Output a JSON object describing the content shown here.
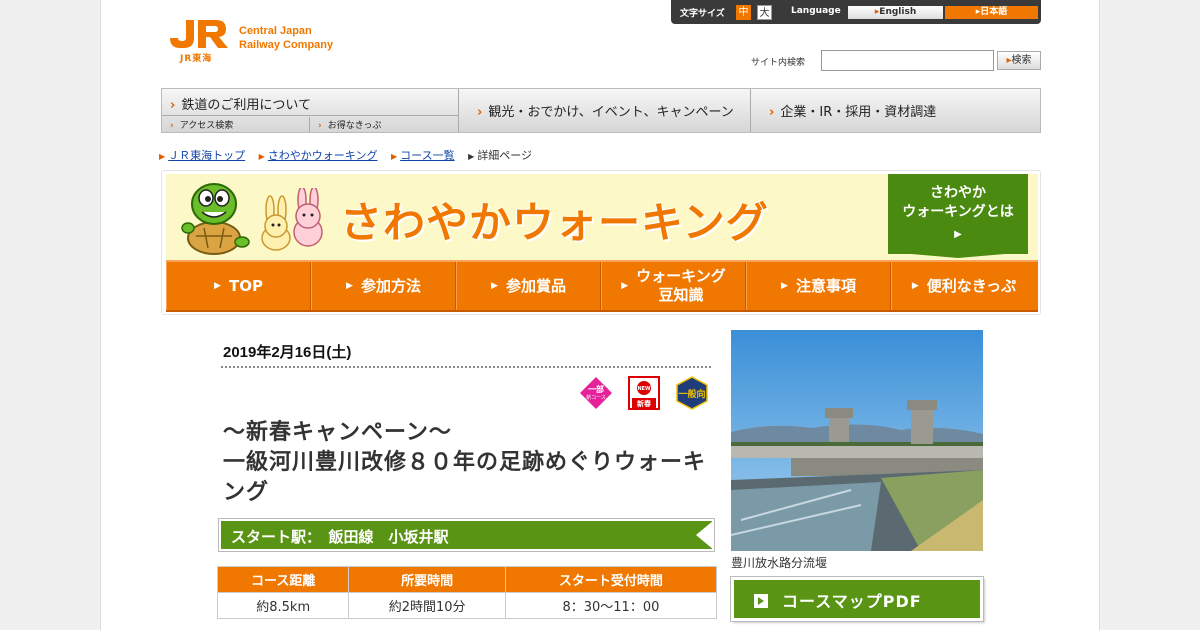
{
  "header": {
    "logo_sub": "JR東海",
    "logo_line1": "Central Japan",
    "logo_line2": "Railway Company",
    "font_size_label": "文字サイズ",
    "font_size_mid": "中",
    "font_size_big": "大",
    "language_label": "Language",
    "lang_english": "English",
    "lang_japanese": "日本語",
    "search_label": "サイト内検索",
    "search_value": "",
    "search_button": "検索"
  },
  "global_nav": {
    "item1": "鉄道のご利用について",
    "item1_sub1": "アクセス検索",
    "item1_sub2": "お得なきっぷ",
    "item2": "観光・おでかけ、イベント、キャンペーン",
    "item3": "企業・IR・採用・資材調達"
  },
  "breadcrumb": {
    "c1": "ＪＲ東海トップ",
    "c2": "さわやかウォーキング",
    "c3": "コース一覧",
    "c4": "詳細ページ"
  },
  "banner": {
    "title": "さわやかウォーキング",
    "about_line1": "さわやか",
    "about_line2": "ウォーキングとは"
  },
  "section_nav": {
    "top": "TOP",
    "how": "参加方法",
    "prize": "参加賞品",
    "tips_line1": "ウォーキング",
    "tips_line2": "豆知識",
    "notes": "注意事項",
    "tickets": "便利なきっぷ"
  },
  "event": {
    "date": "2019年2月16日(土)",
    "badge1_line1": "一部",
    "badge1_line2": "新コース",
    "badge2_line1": "NEW",
    "badge2_line2": "新春",
    "badge3": "一般向",
    "title_line1": "～新春キャンペーン～",
    "title_line2": "一級河川豊川改修８０年の足跡めぐりウォーキ",
    "title_line3": "ング",
    "start_station": "スタート駅：　飯田線　小坂井駅"
  },
  "info_table": {
    "headers": [
      "コース距離",
      "所要時間",
      "スタート受付時間"
    ],
    "values": [
      "約8.5km",
      "約2時間10分",
      "8：30～11：00"
    ]
  },
  "photo": {
    "caption": "豊川放水路分流堰"
  },
  "pdf_button": "コースマップPDF",
  "colors": {
    "orange": "#f07800",
    "green": "#5a9414",
    "banner_bg": "#fdf8c8"
  }
}
